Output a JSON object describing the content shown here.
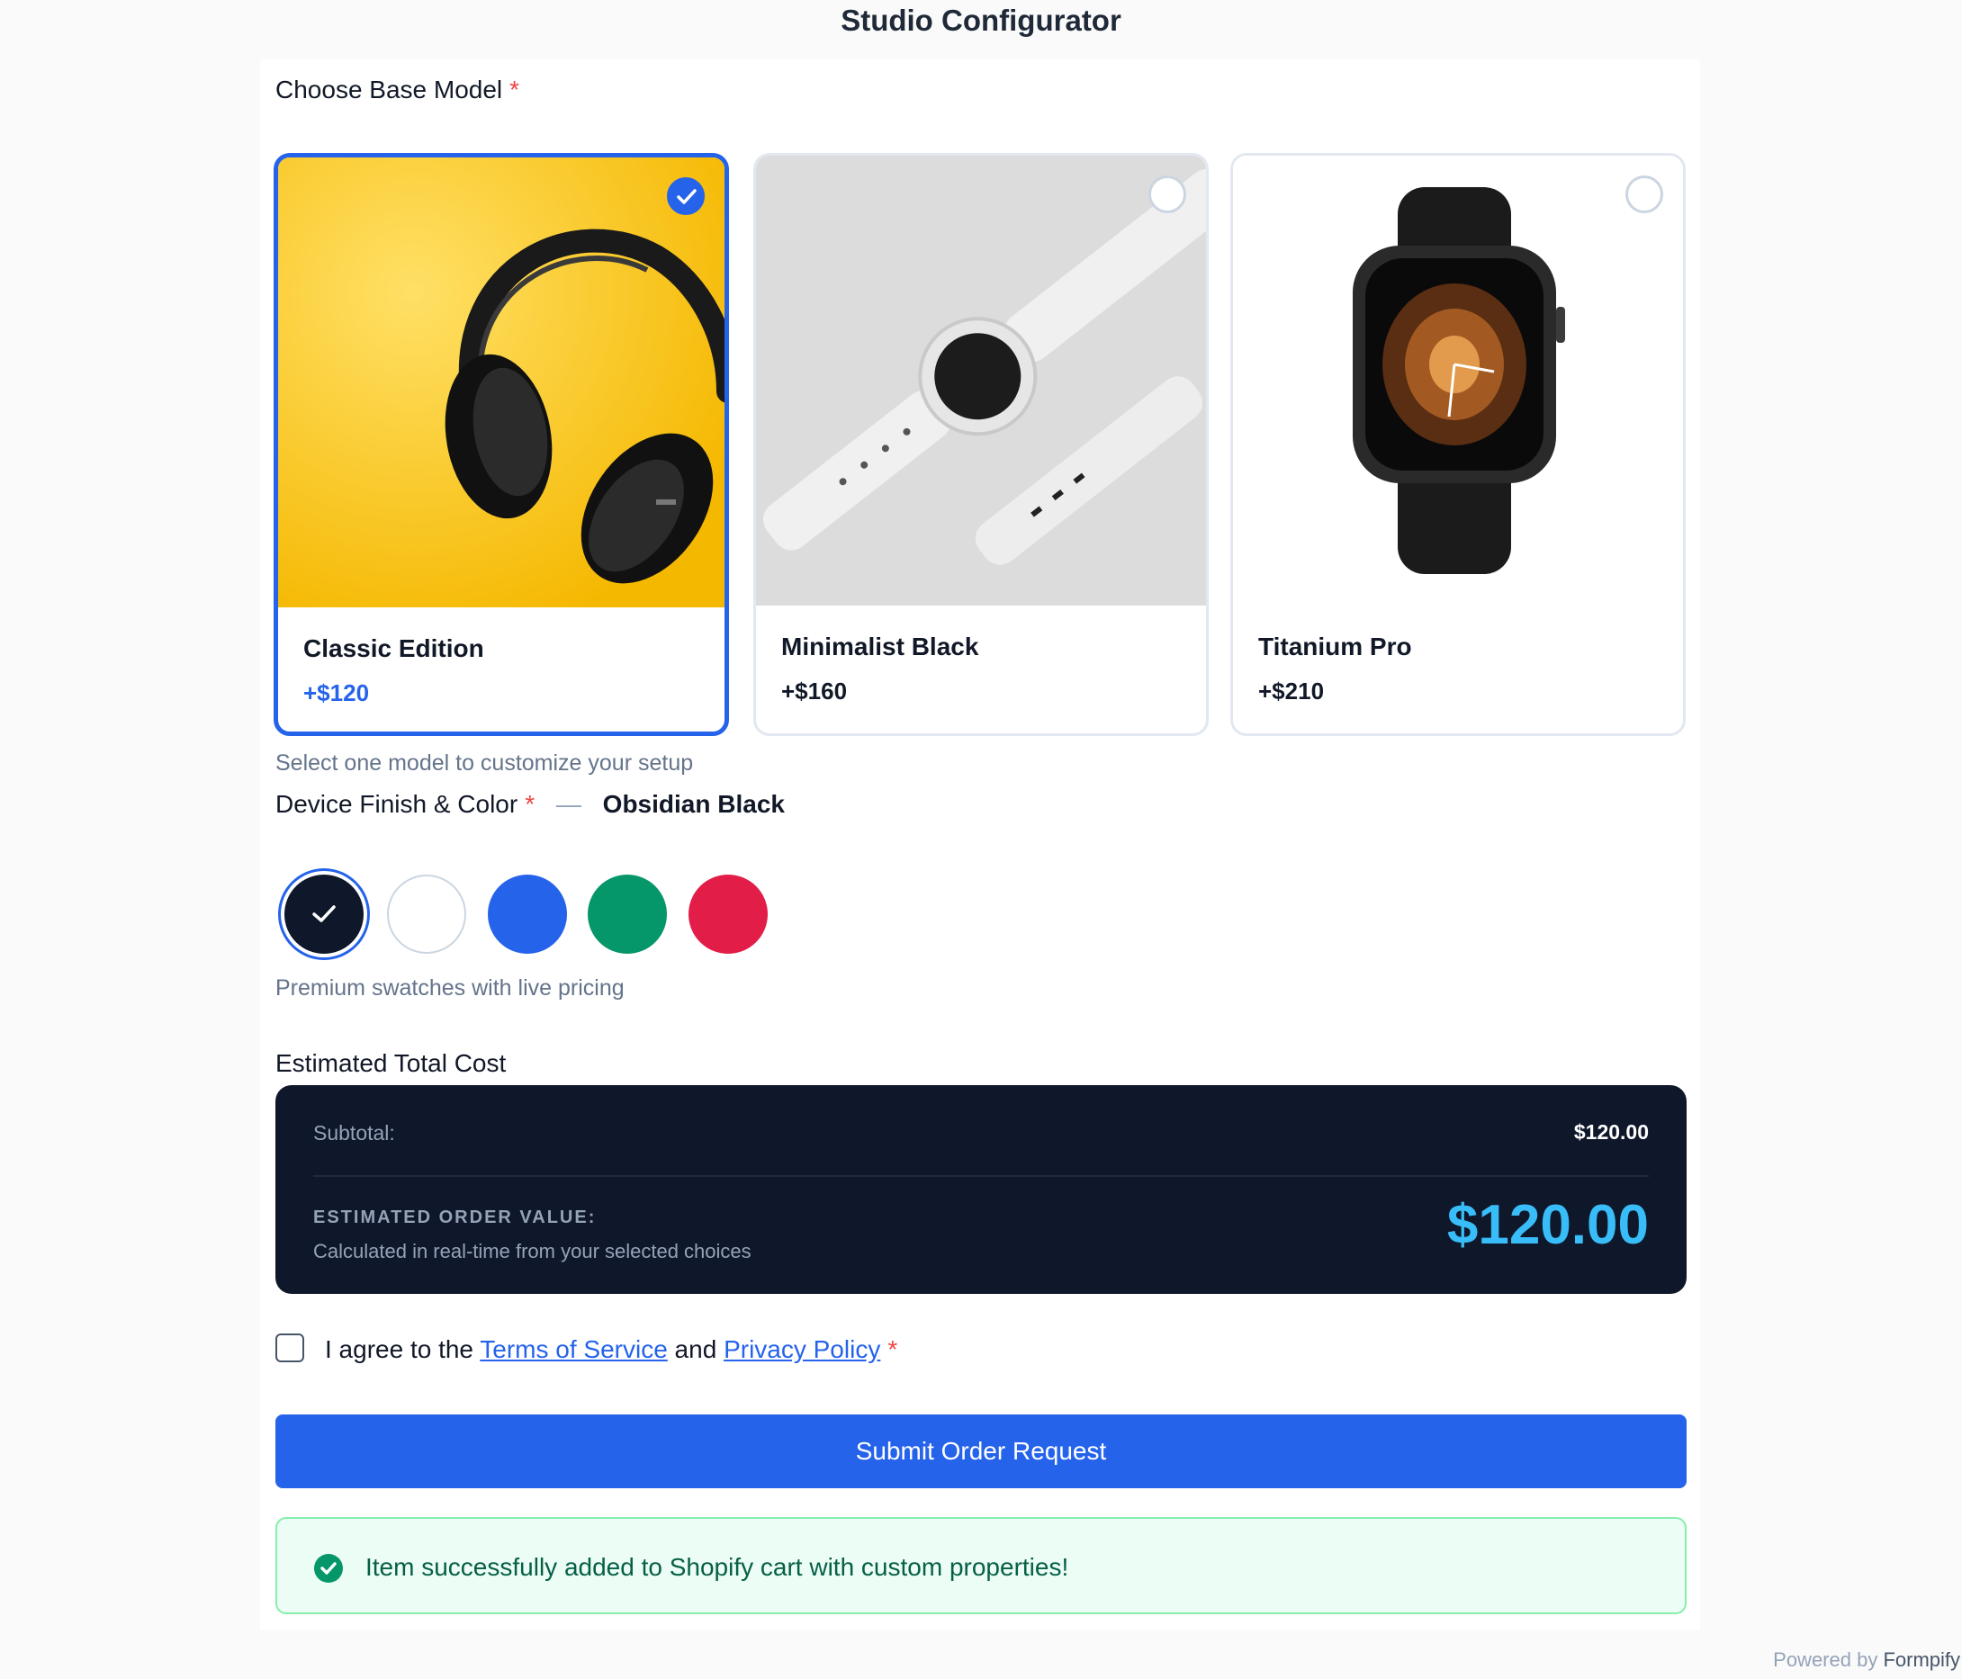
{
  "title": "Studio Configurator",
  "base_model": {
    "label": "Choose Base Model",
    "required_mark": "*",
    "help": "Select one model to customize your setup",
    "cards": [
      {
        "name": "Classic Edition",
        "price": "+$120",
        "selected": true,
        "image": "headphones-on-yellow"
      },
      {
        "name": "Minimalist Black",
        "price": "+$160",
        "selected": false,
        "image": "white-watch-on-gray"
      },
      {
        "name": "Titanium Pro",
        "price": "+$210",
        "selected": false,
        "image": "black-smartwatch"
      }
    ]
  },
  "finish": {
    "label": "Device Finish & Color",
    "required_mark": "*",
    "separator": "—",
    "selected_name": "Obsidian Black",
    "help": "Premium swatches with live pricing",
    "swatches": [
      {
        "color": "#0f172a",
        "selected": true
      },
      {
        "color": "#ffffff",
        "selected": false
      },
      {
        "color": "#2563eb",
        "selected": false
      },
      {
        "color": "#059669",
        "selected": false
      },
      {
        "color": "#e11d48",
        "selected": false
      }
    ]
  },
  "total": {
    "label": "Estimated Total Cost",
    "subtotal_label": "Subtotal:",
    "subtotal_value": "$120.00",
    "estimate_label": "ESTIMATED ORDER VALUE:",
    "estimate_sub": "Calculated in real-time from your selected choices",
    "estimate_value": "$120.00"
  },
  "agreement": {
    "prefix": "I agree to the ",
    "terms": "Terms of Service",
    "middle": " and ",
    "privacy": "Privacy Policy",
    "required_mark": "*",
    "checked": false
  },
  "submit_label": "Submit Order Request",
  "success_message": "Item successfully added to Shopify cart with custom properties!",
  "footer": {
    "prefix": "Powered by ",
    "brand": "Formpify"
  },
  "colors": {
    "accent": "#2563eb",
    "summary_bg": "#0f172a",
    "total": "#38bdf8",
    "success": "#059669"
  }
}
